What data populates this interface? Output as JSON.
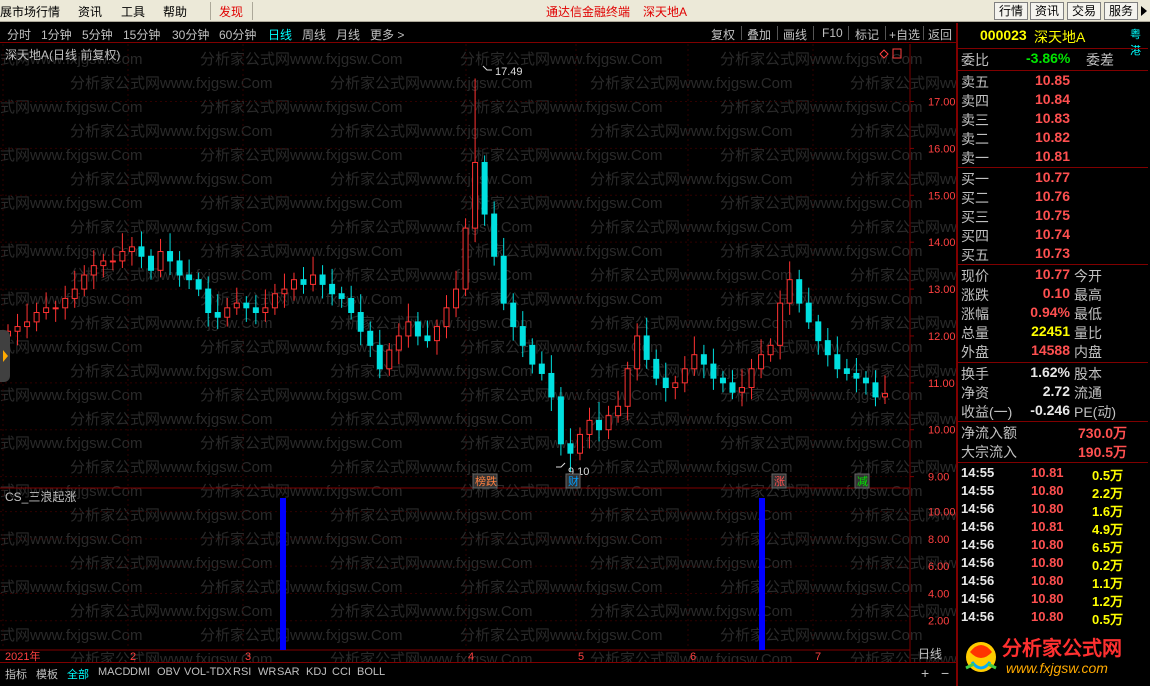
{
  "menu": {
    "items": [
      "展市场行情",
      "资讯",
      "工具",
      "帮助"
    ],
    "discover": "发现",
    "center_title": "通达信金融终端",
    "center_stock": "深天地A",
    "right_buttons": [
      "行情",
      "资讯",
      "交易",
      "服务"
    ]
  },
  "timeframes": [
    "分时",
    "1分钟",
    "5分钟",
    "15分钟",
    "30分钟",
    "60分钟",
    "日线",
    "周线",
    "月线",
    "更多 >"
  ],
  "active_timeframe": "日线",
  "tools": [
    "复权",
    "叠加",
    "画线",
    "F10",
    "标记",
    "+自选",
    "返回"
  ],
  "chart": {
    "main_title": "深天地A(日线 前复权)",
    "price_ticks": [
      "17.00",
      "16.00",
      "15.00",
      "14.00",
      "13.00",
      "12.00",
      "11.00",
      "10.00",
      "9.00"
    ],
    "high_label": "17.49",
    "low_label": "9.10",
    "markers": [
      {
        "text": "榜跌",
        "color": "#ff8040"
      },
      {
        "text": "财",
        "color": "#00a0ff"
      },
      {
        "text": "涨",
        "color": "#ff5050"
      },
      {
        "text": "减",
        "color": "#00e600"
      }
    ],
    "sub_title": "CS_三浪起涨",
    "sub_ticks": [
      "10.00",
      "8.00",
      "6.00",
      "4.00",
      "2.00"
    ],
    "x_labels": [
      "2021年",
      "2",
      "3",
      "4",
      "5",
      "6",
      "7"
    ],
    "corner_label": "日线",
    "watermark": "分析家公式网www.fxjgsw.Com"
  },
  "chart_data": {
    "type": "candlestick",
    "title": "深天地A(日线 前复权)",
    "ylim": [
      8.8,
      17.8
    ],
    "high": 17.49,
    "low": 9.1,
    "close_series_approx": [
      12.1,
      12.2,
      12.3,
      12.5,
      12.6,
      12.6,
      12.8,
      13.0,
      13.3,
      13.5,
      13.6,
      13.6,
      13.8,
      13.9,
      13.7,
      13.4,
      13.8,
      13.6,
      13.3,
      13.2,
      13.0,
      12.5,
      12.4,
      12.6,
      12.7,
      12.6,
      12.5,
      12.6,
      12.9,
      13.0,
      13.2,
      13.1,
      13.3,
      13.1,
      12.9,
      12.8,
      12.5,
      12.1,
      11.8,
      11.3,
      11.7,
      12.0,
      12.3,
      12.0,
      11.9,
      12.2,
      12.6,
      13.0,
      14.3,
      15.7,
      14.6,
      13.7,
      12.7,
      12.2,
      11.8,
      11.4,
      11.2,
      10.7,
      9.7,
      9.5,
      9.9,
      10.2,
      10.0,
      10.3,
      10.5,
      11.3,
      12.0,
      11.5,
      11.1,
      10.9,
      11.0,
      11.3,
      11.6,
      11.4,
      11.1,
      11.0,
      10.8,
      10.9,
      11.3,
      11.6,
      11.8,
      12.7,
      13.2,
      12.7,
      12.3,
      11.9,
      11.6,
      11.3,
      11.2,
      11.1,
      11.0,
      10.7,
      10.77
    ],
    "indicator": {
      "name": "CS_三浪起涨",
      "ylim": [
        0,
        11
      ],
      "signals": [
        {
          "position": "late 2月",
          "value": 11
        },
        {
          "position": "late 6月",
          "value": 11
        }
      ]
    }
  },
  "quote": {
    "code": "000023",
    "name": "深天地A",
    "badge": "粤港",
    "webi_label": "委比",
    "webi_value": "-3.86%",
    "weicha_label": "委差",
    "asks": [
      {
        "label": "卖五",
        "price": "10.85"
      },
      {
        "label": "卖四",
        "price": "10.84"
      },
      {
        "label": "卖三",
        "price": "10.83"
      },
      {
        "label": "卖二",
        "price": "10.82"
      },
      {
        "label": "卖一",
        "price": "10.81"
      }
    ],
    "bids": [
      {
        "label": "买一",
        "price": "10.77"
      },
      {
        "label": "买二",
        "price": "10.76"
      },
      {
        "label": "买三",
        "price": "10.75"
      },
      {
        "label": "买四",
        "price": "10.74"
      },
      {
        "label": "买五",
        "price": "10.73"
      }
    ],
    "stats": [
      {
        "label": "现价",
        "value": "10.77",
        "label2": "今开",
        "cls": "red"
      },
      {
        "label": "涨跌",
        "value": "0.10",
        "label2": "最高",
        "cls": "red"
      },
      {
        "label": "涨幅",
        "value": "0.94%",
        "label2": "最低",
        "cls": "red"
      },
      {
        "label": "总量",
        "value": "22451",
        "label2": "量比",
        "cls": "yellow"
      },
      {
        "label": "外盘",
        "value": "14588",
        "label2": "内盘",
        "cls": "red"
      }
    ],
    "stats2": [
      {
        "label": "换手",
        "value": "1.62%",
        "label2": "股本"
      },
      {
        "label": "净资",
        "value": "2.72",
        "label2": "流通"
      },
      {
        "label": "收益(一)",
        "value": "-0.246",
        "label2": "PE(动)"
      }
    ],
    "flows": [
      {
        "label": "净流入额",
        "value": "730.0万"
      },
      {
        "label": "大宗流入",
        "value": "190.5万"
      }
    ],
    "ticks": [
      {
        "time": "14:55",
        "price": "10.81",
        "vol": "0.5万"
      },
      {
        "time": "14:55",
        "price": "10.80",
        "vol": "2.2万"
      },
      {
        "time": "14:56",
        "price": "10.80",
        "vol": "1.6万"
      },
      {
        "time": "14:56",
        "price": "10.81",
        "vol": "4.9万"
      },
      {
        "time": "14:56",
        "price": "10.80",
        "vol": "6.5万"
      },
      {
        "time": "14:56",
        "price": "10.80",
        "vol": "0.2万"
      },
      {
        "time": "14:56",
        "price": "10.80",
        "vol": "1.1万"
      },
      {
        "time": "14:56",
        "price": "10.80",
        "vol": "1.2万"
      },
      {
        "time": "14:56",
        "price": "10.80",
        "vol": "0.5万"
      }
    ]
  },
  "bottom_tabs": [
    "指标",
    "模板",
    "全部",
    "MACD",
    "DMI",
    "OBV",
    "VOL-TDX",
    "RSI",
    "WR",
    "SAR",
    "KDJ",
    "CCI",
    "BOLL"
  ],
  "active_bottom_tab": "全部",
  "logo": {
    "title": "分析家公式网",
    "url": "www.fxjgsw.com"
  },
  "colors": {
    "up": "#ff3232",
    "down": "#00e0e0",
    "grid": "#800000",
    "signal": "#0000ff"
  }
}
